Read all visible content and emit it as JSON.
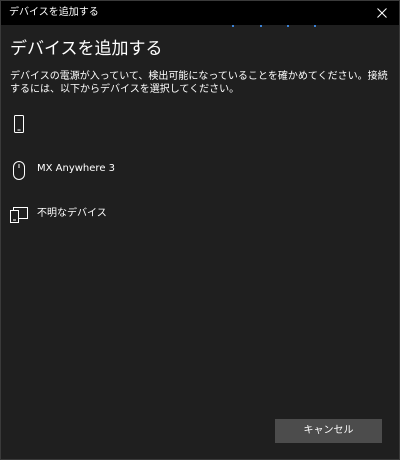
{
  "window": {
    "title": "デバイスを追加する",
    "close_icon": "close-icon"
  },
  "main": {
    "heading": "デバイスを追加する",
    "description": "デバイスの電源が入っていて、検出可能になっていることを確かめてください。接続するには、以下からデバイスを選択してください。"
  },
  "devices": [
    {
      "label": "",
      "icon": "phone-icon"
    },
    {
      "label": "MX Anywhere 3",
      "icon": "mouse-icon"
    },
    {
      "label": "不明なデバイス",
      "icon": "unknown-device-icon"
    }
  ],
  "footer": {
    "cancel_label": "キャンセル"
  },
  "colors": {
    "background": "#1f1f1f",
    "titlebar": "#000000",
    "button": "#4c4c4c",
    "accent": "#3b82d6",
    "text": "#ffffff"
  }
}
